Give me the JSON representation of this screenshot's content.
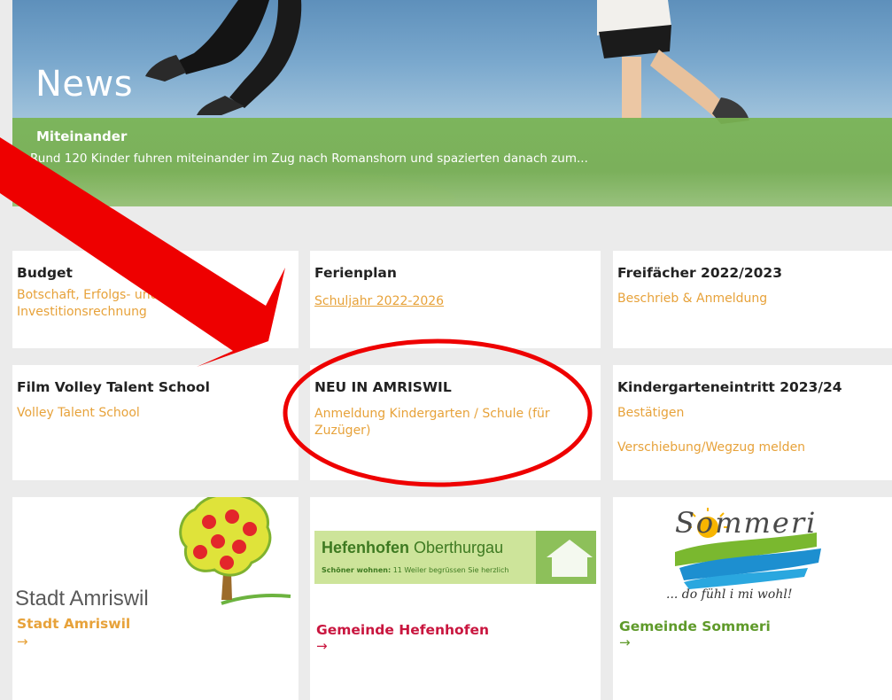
{
  "hero": {
    "title": "News",
    "band_title": "Miteinander",
    "band_text": "Rund 120 Kinder fuhren miteinander im Zug nach Romanshorn und spazierten danach zum..."
  },
  "cards": {
    "budget": {
      "title": "Budget",
      "link": "Botschaft, Erfolgs- und Investitionsrechnung"
    },
    "ferienplan": {
      "title": "Ferienplan",
      "link": "Schuljahr 2022-2026"
    },
    "freifaecher": {
      "title": "Freifächer 2022/2023",
      "link": "Beschrieb & Anmeldung"
    },
    "film": {
      "title": "Film Volley Talent School",
      "link": "Volley Talent School"
    },
    "neu": {
      "title": "NEU IN AMRISWIL",
      "link": "Anmeldung Kindergarten / Schule (für Zuzüger)"
    },
    "kiga": {
      "title": "Kindergarteneintritt 2023/24",
      "link1": "Bestätigen",
      "link2": "Verschiebung/Wegzug melden"
    }
  },
  "logos": {
    "amriswil": {
      "logo_text": "Stadt Amriswil",
      "name": "Stadt Amriswil",
      "arrow": "→"
    },
    "hefenhofen": {
      "logo_title_bold": "Hefenhofen",
      "logo_title_rest": "Oberthurgau",
      "logo_sub_bold": "Schöner wohnen:",
      "logo_sub_rest": "11 Weiler begrüssen Sie herzlich",
      "name": "Gemeinde Hefenhofen",
      "arrow": "→"
    },
    "sommeri": {
      "logo_title": "Sommeri",
      "logo_slogan": "... do fühl i mi wohl!",
      "name": "Gemeinde Sommeri",
      "arrow": "→"
    }
  },
  "colors": {
    "link": "#e7a23a",
    "green_band": "#7ab452",
    "hefenhofen_red": "#c9163f",
    "sommeri_green": "#5f9a2a",
    "annotation_red": "#ee0000"
  }
}
